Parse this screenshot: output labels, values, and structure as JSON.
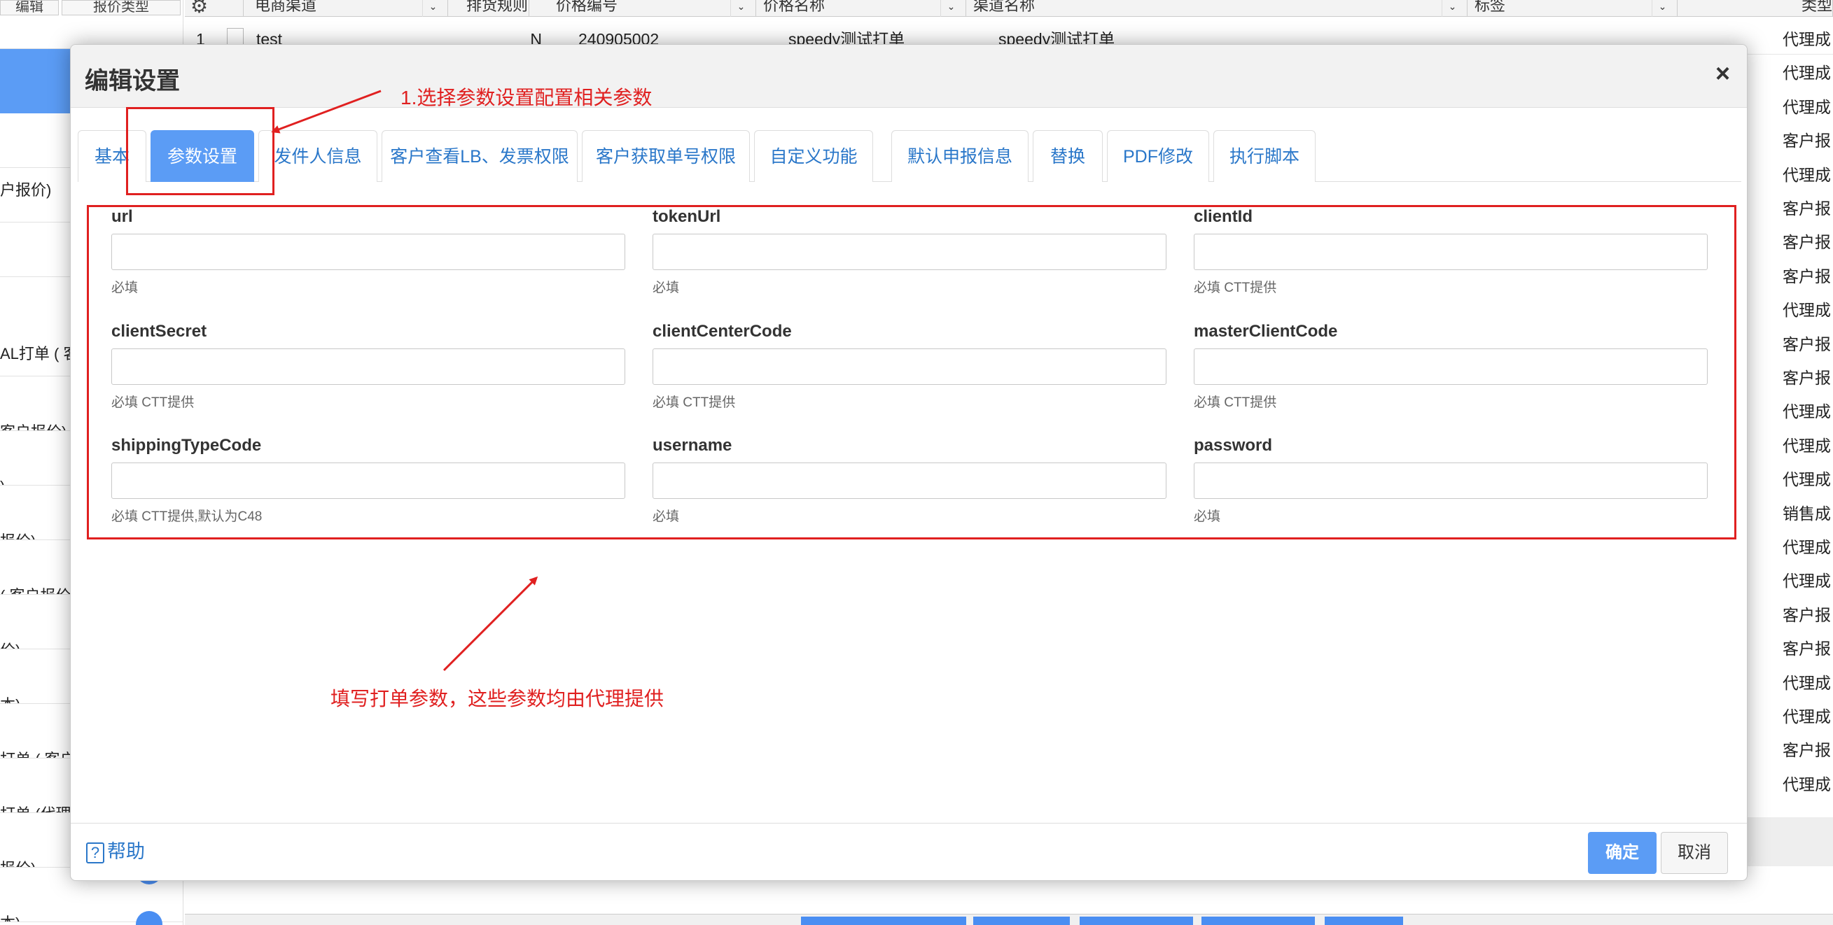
{
  "background": {
    "left_top_buttons": [
      "编辑",
      "报价类型"
    ],
    "left_items": [
      "户报价)",
      "AL打单 ( 客",
      "客户报价)",
      ")",
      "报价)",
      "( 客户报价",
      "价)",
      "本)",
      "打单 ( 客户",
      "打单 (代理",
      "报价)",
      "本)"
    ],
    "grid_headers": [
      "",
      "电商渠道",
      "排货规则",
      "价格编号",
      "价格名称",
      "渠道名称",
      "标签",
      "类型"
    ],
    "grid_first_row": {
      "no": "1",
      "code": "test",
      "rule": "N",
      "price_no": "240905002",
      "price_name": "speedy测试打单",
      "channel_name": "speedy测试打单"
    },
    "grid_right_column": [
      "代理成",
      "代理成",
      "代理成",
      "客户报",
      "代理成",
      "客户报",
      "客户报",
      "客户报",
      "代理成",
      "客户报",
      "客户报",
      "代理成",
      "代理成",
      "代理成",
      "销售成",
      "代理成",
      "代理成",
      "客户报",
      "客户报",
      "代理成",
      "代理成",
      "客户报",
      "代理成"
    ]
  },
  "dialog": {
    "title": "编辑设置",
    "close_symbol": "×",
    "tabs": [
      "基本",
      "参数设置",
      "发件人信息",
      "客户查看LB、发票权限",
      "客户获取单号权限",
      "自定义功能",
      "默认申报信息",
      "替换",
      "PDF修改",
      "执行脚本"
    ],
    "active_tab": "参数设置",
    "fields": [
      {
        "label": "url",
        "value": "",
        "hint": "必填"
      },
      {
        "label": "tokenUrl",
        "value": "",
        "hint": "必填"
      },
      {
        "label": "clientId",
        "value": "",
        "hint": "必填 CTT提供"
      },
      {
        "label": "clientSecret",
        "value": "",
        "hint": "必填 CTT提供"
      },
      {
        "label": "clientCenterCode",
        "value": "",
        "hint": "必填 CTT提供"
      },
      {
        "label": "masterClientCode",
        "value": "",
        "hint": "必填 CTT提供"
      },
      {
        "label": "shippingTypeCode",
        "value": "",
        "hint": "必填 CTT提供,默认为C48"
      },
      {
        "label": "username",
        "value": "",
        "hint": "必填"
      },
      {
        "label": "password",
        "value": "",
        "hint": "必填"
      }
    ],
    "help_label": "帮助",
    "help_icon": "?",
    "ok_label": "确定",
    "cancel_label": "取消"
  },
  "annotations": {
    "step1": "1.选择参数设置配置相关参数",
    "step2": "填写打单参数，这些参数均由代理提供",
    "color": "#e02020"
  },
  "colors": {
    "accent": "#5b9cf5",
    "link": "#2a77c9",
    "annotation": "#e02020"
  }
}
